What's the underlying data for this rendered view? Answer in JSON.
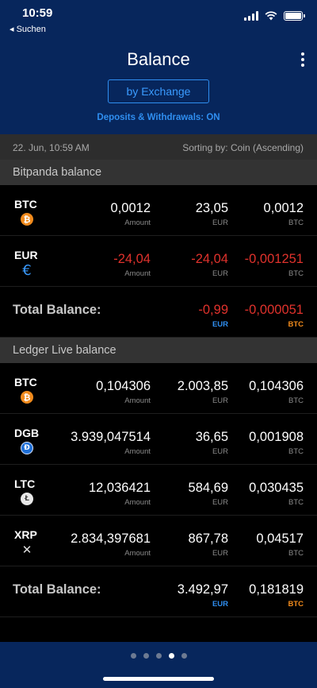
{
  "status": {
    "time": "10:59",
    "back": "◂ Suchen"
  },
  "header": {
    "title": "Balance",
    "exchange_button": "by Exchange",
    "deposits_note": "Deposits & Withdrawals: ON"
  },
  "subbar": {
    "date": "22. Jun, 10:59 AM",
    "sorting": "Sorting by: Coin (Ascending)"
  },
  "sections": [
    {
      "title": "Bitpanda balance",
      "rows": [
        {
          "coin": "BTC",
          "icon": "bitcoin-icon",
          "glyph": "₿",
          "amount": "0,0012",
          "eur": "23,05",
          "btc": "0,0012",
          "negative": false
        },
        {
          "coin": "EUR",
          "icon": "euro-icon",
          "glyph": "€",
          "amount": "-24,04",
          "eur": "-24,04",
          "btc": "-0,001251",
          "negative": true
        }
      ],
      "total": {
        "label": "Total Balance:",
        "eur": "-0,99",
        "btc": "-0,000051",
        "negative": true
      }
    },
    {
      "title": "Ledger Live balance",
      "rows": [
        {
          "coin": "BTC",
          "icon": "bitcoin-icon",
          "glyph": "₿",
          "amount": "0,104306",
          "eur": "2.003,85",
          "btc": "0,104306",
          "negative": false
        },
        {
          "coin": "DGB",
          "icon": "digibyte-icon",
          "glyph": "Ð",
          "amount": "3.939,047514",
          "eur": "36,65",
          "btc": "0,001908",
          "negative": false
        },
        {
          "coin": "LTC",
          "icon": "litecoin-icon",
          "glyph": "Ł",
          "amount": "12,036421",
          "eur": "584,69",
          "btc": "0,030435",
          "negative": false
        },
        {
          "coin": "XRP",
          "icon": "ripple-icon",
          "glyph": "✕",
          "amount": "2.834,397681",
          "eur": "867,78",
          "btc": "0,04517",
          "negative": false
        }
      ],
      "total": {
        "label": "Total Balance:",
        "eur": "3.492,97",
        "btc": "0,181819",
        "negative": false
      }
    }
  ],
  "units": {
    "amount": "Amount",
    "eur": "EUR",
    "btc": "BTC"
  },
  "pagination": {
    "count": 5,
    "active": 3
  },
  "colors": {
    "header_bg": "#07265c",
    "accent_blue": "#2f8ef0",
    "negative_red": "#e0322c",
    "btc_orange": "#f08a1c"
  }
}
